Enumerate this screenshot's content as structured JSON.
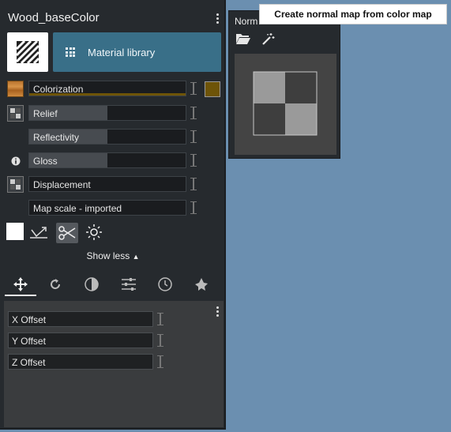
{
  "panel": {
    "title": "Wood_baseColor",
    "material_library_label": "Material library"
  },
  "channels": [
    {
      "label": "Colorization",
      "icon": "wood-texture-icon",
      "swatch_color": "#6e5408"
    },
    {
      "label": "Relief",
      "icon": "checker-map-icon",
      "level": 0.5
    },
    {
      "label": "Reflectivity",
      "icon": "",
      "level": 0.5
    },
    {
      "label": "Gloss",
      "icon": "info-icon",
      "level": 0.5
    },
    {
      "label": "Displacement",
      "icon": "checker-map-icon"
    },
    {
      "label": "Map scale - imported",
      "icon": ""
    }
  ],
  "tools": [
    "white-color-icon",
    "projection-icon",
    "scissors-icon",
    "brightness-icon"
  ],
  "show_less_label": "Show less",
  "tabs": [
    "move-icon",
    "rotate-icon",
    "contrast-icon",
    "sliders-icon",
    "clock-icon",
    "leaf-icon"
  ],
  "offsets": [
    {
      "label": "X Offset"
    },
    {
      "label": "Y Offset"
    },
    {
      "label": "Z Offset"
    }
  ],
  "normal_panel": {
    "title": "Norm",
    "tooltip": "Create normal map from color map"
  },
  "colors": {
    "accent": "#396f88",
    "background": "#6b8fb0",
    "panel": "#262a2e"
  }
}
